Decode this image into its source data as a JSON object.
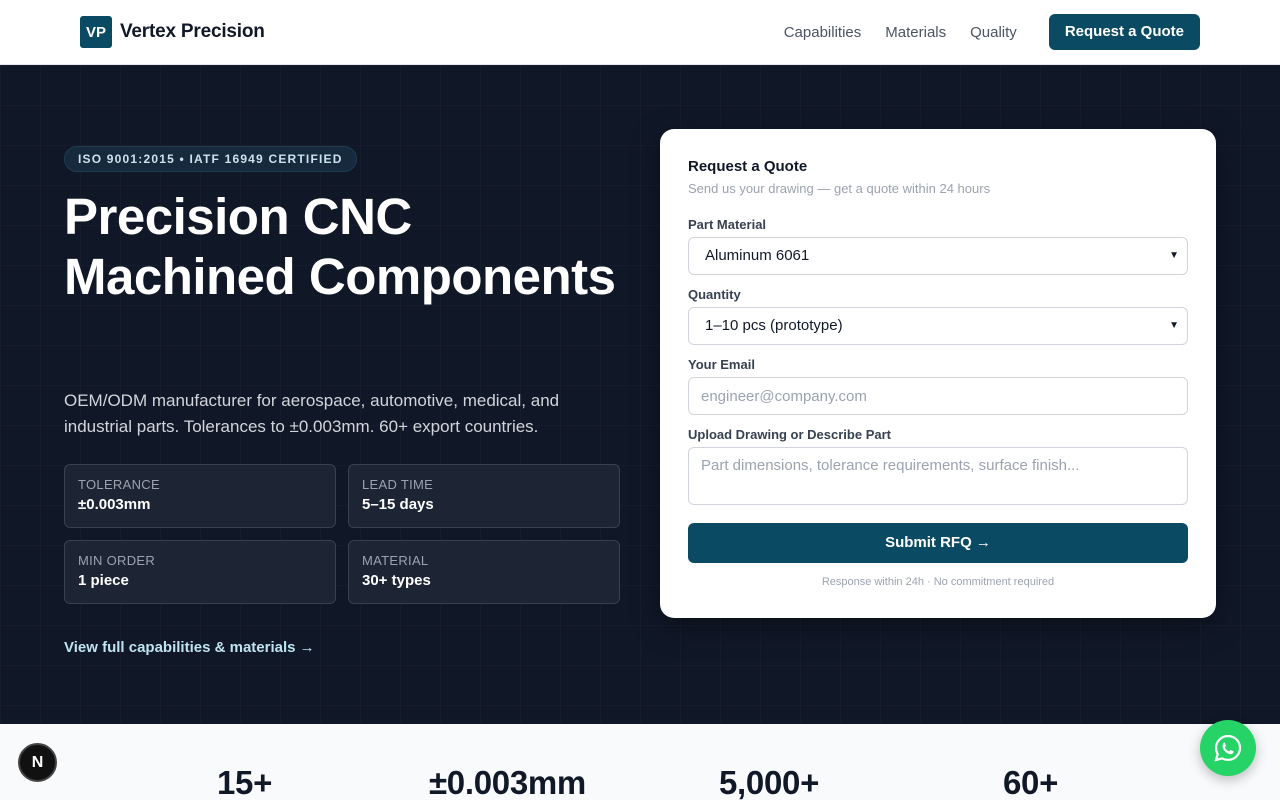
{
  "brand": {
    "mark": "VP",
    "name": "Vertex Precision"
  },
  "nav": {
    "links": [
      "Capabilities",
      "Materials",
      "Quality"
    ],
    "cta": "Request a Quote"
  },
  "hero": {
    "badge": "ISO 9001:2015 • IATF 16949 CERTIFIED",
    "title": "Precision CNC Machined Components",
    "description": "OEM/ODM manufacturer for aerospace, automotive, medical, and industrial parts. Tolerances to ±0.003mm. 60+ export countries.",
    "specs": [
      {
        "label": "Tolerance",
        "value": "±0.003mm"
      },
      {
        "label": "Lead Time",
        "value": "5–15 days"
      },
      {
        "label": "Min Order",
        "value": "1 piece"
      },
      {
        "label": "Material",
        "value": "30+ types"
      }
    ],
    "link": "View full capabilities & materials →"
  },
  "quote_form": {
    "title": "Request a Quote",
    "subtitle": "Send us your drawing — get a quote within 24 hours",
    "material_label": "Part Material",
    "material_value": "Aluminum 6061",
    "quantity_label": "Quantity",
    "quantity_value": "1–10 pcs (prototype)",
    "email_label": "Your Email",
    "email_placeholder": "engineer@company.com",
    "drawing_label": "Upload Drawing or Describe Part",
    "drawing_placeholder": "Part dimensions, tolerance requirements, surface finish...",
    "submit": "Submit RFQ →",
    "fine_print": "Response within 24h · No commitment required"
  },
  "stats": [
    "15+",
    "±0.003mm",
    "5,000+",
    "60+"
  ],
  "dev_badge": "N",
  "colors": {
    "brand": "#0b4a63",
    "hero_bg": "#101727",
    "whatsapp": "#25d366"
  },
  "icons": {
    "chat": "whatsapp-icon",
    "select": "chevron-down-icon"
  }
}
